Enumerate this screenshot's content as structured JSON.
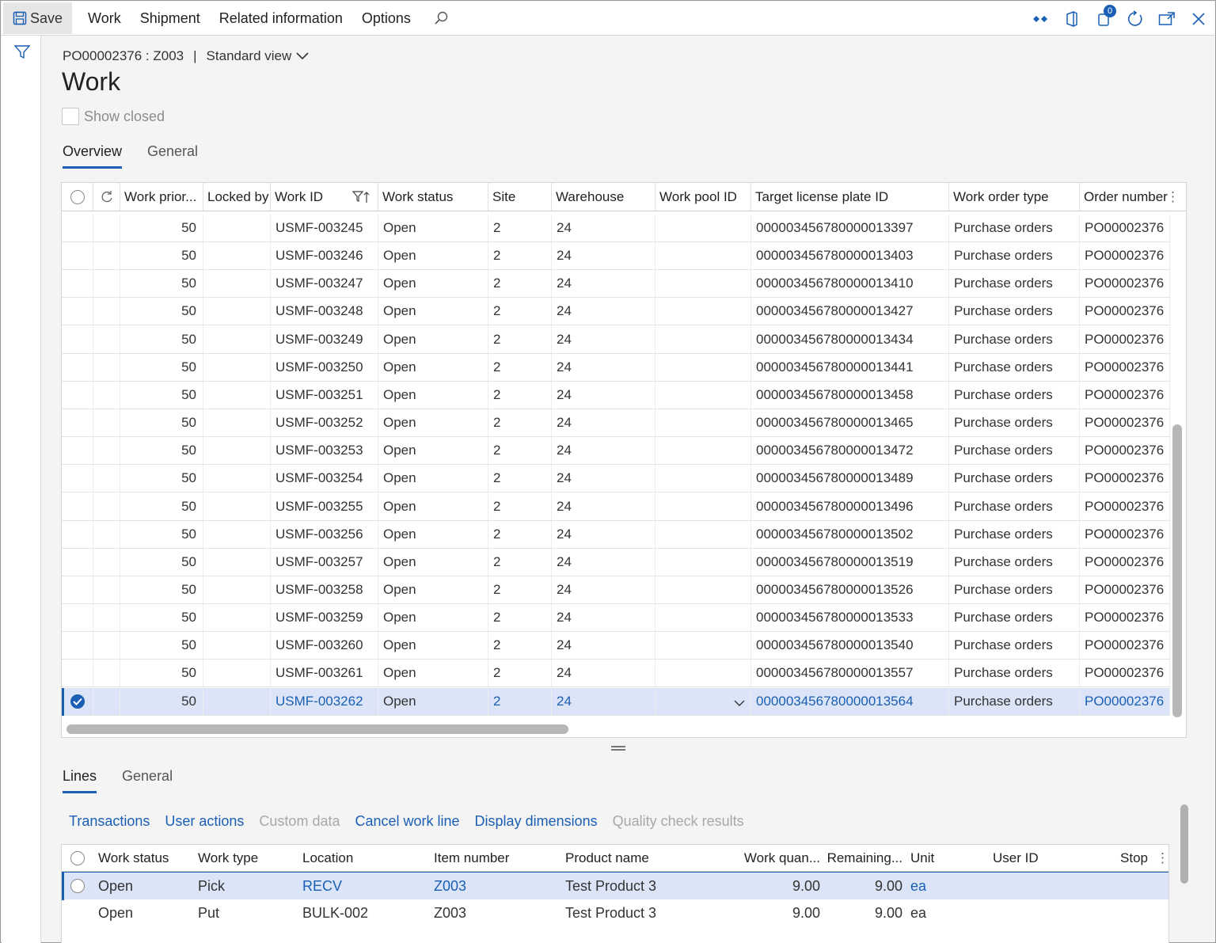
{
  "actionbar": {
    "save": "Save",
    "menu": [
      "Work",
      "Shipment",
      "Related information",
      "Options"
    ],
    "notification_count": "0"
  },
  "header": {
    "breadcrumb_record": "PO00002376 : Z003",
    "breadcrumb_sep": "|",
    "view_name": "Standard view",
    "title": "Work",
    "show_closed_label": "Show closed"
  },
  "tabs_top": [
    "Overview",
    "General"
  ],
  "grid": {
    "columns": [
      "Work prior...",
      "Locked by",
      "Work ID",
      "Work status",
      "Site",
      "Warehouse",
      "Work pool ID",
      "Target license plate ID",
      "Work order type",
      "Order number"
    ],
    "rows": [
      {
        "priority": "50",
        "locked_by": "",
        "work_id": "USMF-003245",
        "status": "Open",
        "site": "2",
        "warehouse": "24",
        "pool": "",
        "lp": "000003456780000013397",
        "type": "Purchase orders",
        "order": "PO00002376"
      },
      {
        "priority": "50",
        "locked_by": "",
        "work_id": "USMF-003246",
        "status": "Open",
        "site": "2",
        "warehouse": "24",
        "pool": "",
        "lp": "000003456780000013403",
        "type": "Purchase orders",
        "order": "PO00002376"
      },
      {
        "priority": "50",
        "locked_by": "",
        "work_id": "USMF-003247",
        "status": "Open",
        "site": "2",
        "warehouse": "24",
        "pool": "",
        "lp": "000003456780000013410",
        "type": "Purchase orders",
        "order": "PO00002376"
      },
      {
        "priority": "50",
        "locked_by": "",
        "work_id": "USMF-003248",
        "status": "Open",
        "site": "2",
        "warehouse": "24",
        "pool": "",
        "lp": "000003456780000013427",
        "type": "Purchase orders",
        "order": "PO00002376"
      },
      {
        "priority": "50",
        "locked_by": "",
        "work_id": "USMF-003249",
        "status": "Open",
        "site": "2",
        "warehouse": "24",
        "pool": "",
        "lp": "000003456780000013434",
        "type": "Purchase orders",
        "order": "PO00002376"
      },
      {
        "priority": "50",
        "locked_by": "",
        "work_id": "USMF-003250",
        "status": "Open",
        "site": "2",
        "warehouse": "24",
        "pool": "",
        "lp": "000003456780000013441",
        "type": "Purchase orders",
        "order": "PO00002376"
      },
      {
        "priority": "50",
        "locked_by": "",
        "work_id": "USMF-003251",
        "status": "Open",
        "site": "2",
        "warehouse": "24",
        "pool": "",
        "lp": "000003456780000013458",
        "type": "Purchase orders",
        "order": "PO00002376"
      },
      {
        "priority": "50",
        "locked_by": "",
        "work_id": "USMF-003252",
        "status": "Open",
        "site": "2",
        "warehouse": "24",
        "pool": "",
        "lp": "000003456780000013465",
        "type": "Purchase orders",
        "order": "PO00002376"
      },
      {
        "priority": "50",
        "locked_by": "",
        "work_id": "USMF-003253",
        "status": "Open",
        "site": "2",
        "warehouse": "24",
        "pool": "",
        "lp": "000003456780000013472",
        "type": "Purchase orders",
        "order": "PO00002376"
      },
      {
        "priority": "50",
        "locked_by": "",
        "work_id": "USMF-003254",
        "status": "Open",
        "site": "2",
        "warehouse": "24",
        "pool": "",
        "lp": "000003456780000013489",
        "type": "Purchase orders",
        "order": "PO00002376"
      },
      {
        "priority": "50",
        "locked_by": "",
        "work_id": "USMF-003255",
        "status": "Open",
        "site": "2",
        "warehouse": "24",
        "pool": "",
        "lp": "000003456780000013496",
        "type": "Purchase orders",
        "order": "PO00002376"
      },
      {
        "priority": "50",
        "locked_by": "",
        "work_id": "USMF-003256",
        "status": "Open",
        "site": "2",
        "warehouse": "24",
        "pool": "",
        "lp": "000003456780000013502",
        "type": "Purchase orders",
        "order": "PO00002376"
      },
      {
        "priority": "50",
        "locked_by": "",
        "work_id": "USMF-003257",
        "status": "Open",
        "site": "2",
        "warehouse": "24",
        "pool": "",
        "lp": "000003456780000013519",
        "type": "Purchase orders",
        "order": "PO00002376"
      },
      {
        "priority": "50",
        "locked_by": "",
        "work_id": "USMF-003258",
        "status": "Open",
        "site": "2",
        "warehouse": "24",
        "pool": "",
        "lp": "000003456780000013526",
        "type": "Purchase orders",
        "order": "PO00002376"
      },
      {
        "priority": "50",
        "locked_by": "",
        "work_id": "USMF-003259",
        "status": "Open",
        "site": "2",
        "warehouse": "24",
        "pool": "",
        "lp": "000003456780000013533",
        "type": "Purchase orders",
        "order": "PO00002376"
      },
      {
        "priority": "50",
        "locked_by": "",
        "work_id": "USMF-003260",
        "status": "Open",
        "site": "2",
        "warehouse": "24",
        "pool": "",
        "lp": "000003456780000013540",
        "type": "Purchase orders",
        "order": "PO00002376"
      },
      {
        "priority": "50",
        "locked_by": "",
        "work_id": "USMF-003261",
        "status": "Open",
        "site": "2",
        "warehouse": "24",
        "pool": "",
        "lp": "000003456780000013557",
        "type": "Purchase orders",
        "order": "PO00002376"
      },
      {
        "priority": "50",
        "locked_by": "",
        "work_id": "USMF-003262",
        "status": "Open",
        "site": "2",
        "warehouse": "24",
        "pool": "",
        "lp": "000003456780000013564",
        "type": "Purchase orders",
        "order": "PO00002376",
        "selected": true
      }
    ]
  },
  "tabs_bottom": [
    "Lines",
    "General"
  ],
  "line_actions": [
    {
      "label": "Transactions",
      "enabled": true
    },
    {
      "label": "User actions",
      "enabled": true
    },
    {
      "label": "Custom data",
      "enabled": false
    },
    {
      "label": "Cancel work line",
      "enabled": true
    },
    {
      "label": "Display dimensions",
      "enabled": true
    },
    {
      "label": "Quality check results",
      "enabled": false
    }
  ],
  "lines": {
    "columns": [
      "Work status",
      "Work type",
      "Location",
      "Item number",
      "Product name",
      "Work quan...",
      "Remaining...",
      "Unit",
      "User ID",
      "Stop"
    ],
    "rows": [
      {
        "status": "Open",
        "type": "Pick",
        "location": "RECV",
        "item": "Z003",
        "product": "Test Product 3",
        "qty": "9.00",
        "remaining": "9.00",
        "unit": "ea",
        "user": "",
        "stop": "",
        "selected": true
      },
      {
        "status": "Open",
        "type": "Put",
        "location": "BULK-002",
        "item": "Z003",
        "product": "Test Product 3",
        "qty": "9.00",
        "remaining": "9.00",
        "unit": "ea",
        "user": "",
        "stop": ""
      }
    ]
  },
  "colors": {
    "accent": "#1a5fb4",
    "selected_row": "#dbe5f7"
  }
}
